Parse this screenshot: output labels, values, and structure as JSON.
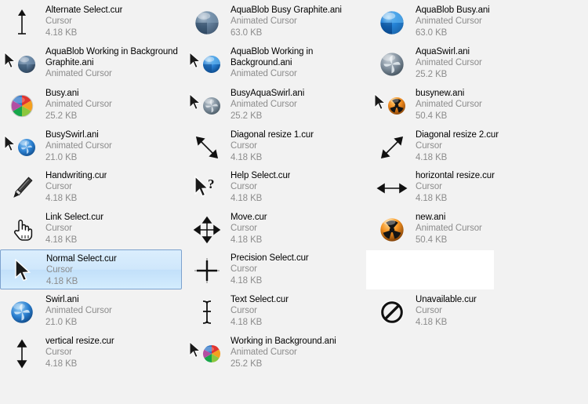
{
  "window": {
    "view_mode": "tiles",
    "background_color": "#f2f2f2",
    "selection_color": "#cfe7fb",
    "selection_border_color": "#7da2ce"
  },
  "labels": {
    "type_cursor": "Cursor",
    "type_animated_cursor": "Animated Cursor"
  },
  "columns": [
    {
      "index": 0,
      "items": [
        {
          "name": "Alternate Select.cur",
          "type": "Cursor",
          "size": "4.18 KB",
          "icon": "vertical-arrow-up-cursor-icon",
          "selected": false
        },
        {
          "name": "AquaBlob Working in Background\nGraphite.ani",
          "type": "Animated Cursor",
          "size": "",
          "icon": "arrow-with-graphite-orb-icon",
          "selected": false
        },
        {
          "name": "Busy.ani",
          "type": "Animated Cursor",
          "size": "25.2 KB",
          "icon": "color-pinwheel-icon",
          "selected": false
        },
        {
          "name": "BusySwirl.ani",
          "type": "Animated Cursor",
          "size": "21.0 KB",
          "icon": "arrow-with-blue-swirl-orb-icon",
          "selected": false
        },
        {
          "name": "Handwriting.cur",
          "type": "Cursor",
          "size": "4.18 KB",
          "icon": "pen-handwriting-icon",
          "selected": false
        },
        {
          "name": "Link Select.cur",
          "type": "Cursor",
          "size": "4.18 KB",
          "icon": "hand-pointer-icon",
          "selected": false
        },
        {
          "name": "Normal Select.cur",
          "type": "Cursor",
          "size": "4.18 KB",
          "icon": "arrow-pointer-icon",
          "selected": true
        },
        {
          "name": "Swirl.ani",
          "type": "Animated Cursor",
          "size": "21.0 KB",
          "icon": "blue-swirl-orb-icon",
          "selected": false
        },
        {
          "name": "vertical resize.cur",
          "type": "Cursor",
          "size": "4.18 KB",
          "icon": "vertical-resize-icon",
          "selected": false
        }
      ]
    },
    {
      "index": 1,
      "items": [
        {
          "name": "AquaBlob Busy Graphite.ani",
          "type": "Animated Cursor",
          "size": "63.0 KB",
          "icon": "graphite-blob-orb-icon",
          "selected": false
        },
        {
          "name": "AquaBlob Working in\nBackground.ani",
          "type": "Animated Cursor",
          "size": "",
          "icon": "arrow-with-blue-blob-orb-icon",
          "selected": false
        },
        {
          "name": "BusyAquaSwirl.ani",
          "type": "Animated Cursor",
          "size": "25.2 KB",
          "icon": "arrow-with-gray-swirl-orb-icon",
          "selected": false
        },
        {
          "name": "Diagonal resize 1.cur",
          "type": "Cursor",
          "size": "4.18 KB",
          "icon": "diagonal-resize-nwse-icon",
          "selected": false
        },
        {
          "name": "Help Select.cur",
          "type": "Cursor",
          "size": "4.18 KB",
          "icon": "arrow-question-mark-icon",
          "selected": false
        },
        {
          "name": "Move.cur",
          "type": "Cursor",
          "size": "4.18 KB",
          "icon": "move-four-arrows-icon",
          "selected": false
        },
        {
          "name": "Precision Select.cur",
          "type": "Cursor",
          "size": "4.18 KB",
          "icon": "crosshair-icon",
          "selected": false
        },
        {
          "name": "Text Select.cur",
          "type": "Cursor",
          "size": "4.18 KB",
          "icon": "text-ibeam-icon",
          "selected": false
        },
        {
          "name": "Working in Background.ani",
          "type": "Animated Cursor",
          "size": "25.2 KB",
          "icon": "arrow-with-color-pinwheel-icon",
          "selected": false
        }
      ]
    },
    {
      "index": 2,
      "items": [
        {
          "name": "AquaBlob Busy.ani",
          "type": "Animated Cursor",
          "size": "63.0 KB",
          "icon": "blue-blob-orb-icon",
          "selected": false
        },
        {
          "name": "AquaSwirl.ani",
          "type": "Animated Cursor",
          "size": "25.2 KB",
          "icon": "gray-swirl-orb-icon",
          "selected": false
        },
        {
          "name": "busynew.ani",
          "type": "Animated Cursor",
          "size": "50.4 KB",
          "icon": "arrow-with-radiation-orb-icon",
          "selected": false
        },
        {
          "name": "Diagonal resize 2.cur",
          "type": "Cursor",
          "size": "4.18 KB",
          "icon": "diagonal-resize-nesw-icon",
          "selected": false
        },
        {
          "name": "horizontal resize.cur",
          "type": "Cursor",
          "size": "4.18 KB",
          "icon": "horizontal-resize-icon",
          "selected": false
        },
        {
          "name": "new.ani",
          "type": "Animated Cursor",
          "size": "50.4 KB",
          "icon": "radiation-orb-icon",
          "selected": false
        },
        {
          "name": "",
          "type": "",
          "size": "",
          "icon": "blank-tile",
          "selected": false
        },
        {
          "name": "Unavailable.cur",
          "type": "Cursor",
          "size": "4.18 KB",
          "icon": "no-entry-icon",
          "selected": false
        }
      ]
    }
  ]
}
